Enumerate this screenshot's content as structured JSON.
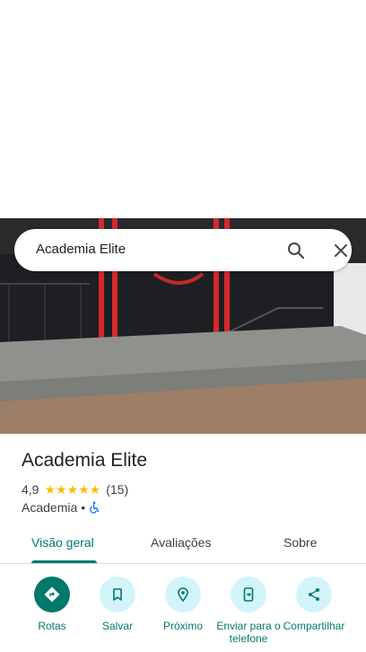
{
  "search": {
    "query": "Academia Elite"
  },
  "place": {
    "name": "Academia Elite",
    "rating": "4,9",
    "stars": "★★★★★",
    "review_count": "(15)",
    "category": "Academia",
    "separator": "•"
  },
  "tabs": [
    {
      "label": "Visão geral",
      "active": true
    },
    {
      "label": "Avaliações",
      "active": false
    },
    {
      "label": "Sobre",
      "active": false
    }
  ],
  "actions": [
    {
      "label": "Rotas",
      "icon": "directions-icon"
    },
    {
      "label": "Salvar",
      "icon": "bookmark-icon"
    },
    {
      "label": "Próximo",
      "icon": "nearby-icon"
    },
    {
      "label": "Enviar para o telefone",
      "icon": "send-to-phone-icon"
    },
    {
      "label": "Compartilhar",
      "icon": "share-icon"
    }
  ],
  "colors": {
    "accent": "#00796b",
    "action_bg": "#d3f4fa",
    "star": "#fbbc04",
    "wheelchair": "#1a73e8"
  }
}
